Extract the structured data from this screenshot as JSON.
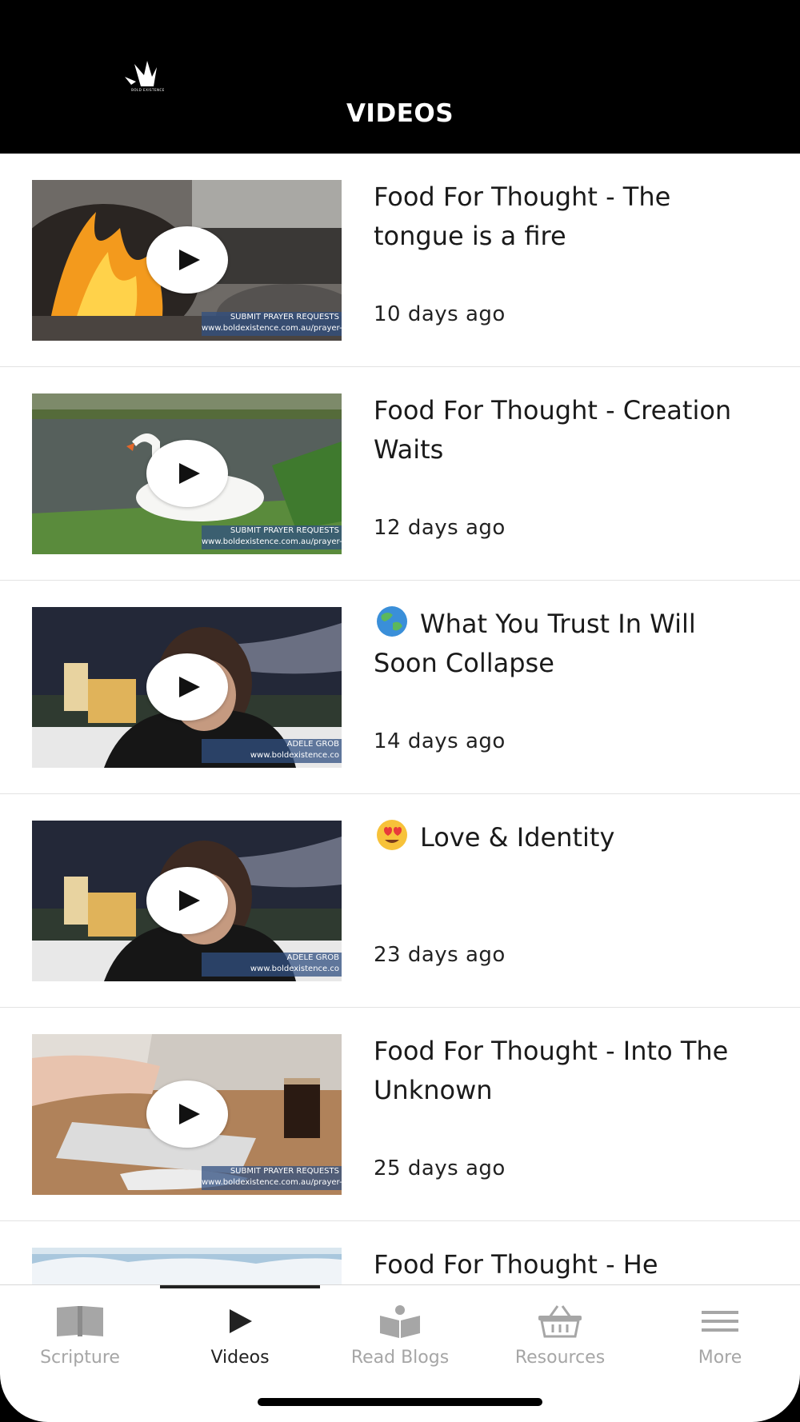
{
  "header": {
    "logo_text": "BOLD EXISTENCE",
    "title": "VIDEOS"
  },
  "videos": [
    {
      "title": "Food For Thought - The tongue is a fire",
      "age": "10 days ago",
      "emoji": "",
      "thumb": "fire",
      "caption_1": "SUBMIT PRAYER REQUESTS",
      "caption_2": "www.boldexistence.com.au/prayer-req"
    },
    {
      "title": "Food For Thought - Creation Waits",
      "age": "12 days ago",
      "emoji": "",
      "thumb": "swan",
      "caption_1": "SUBMIT PRAYER REQUESTS",
      "caption_2": "www.boldexistence.com.au/prayer-reqs"
    },
    {
      "title": "What You Trust In Will Soon Collapse",
      "age": "14 days ago",
      "emoji": "earth-globe-emoji",
      "thumb": "night",
      "caption_1": "ADELE GROB",
      "caption_2": "www.boldexistence.co"
    },
    {
      "title": "Love & Identity",
      "age": "23 days ago",
      "emoji": "heart-eyes-emoji",
      "thumb": "night",
      "caption_1": "ADELE GROB",
      "caption_2": "www.boldexistence.co"
    },
    {
      "title": "Food For Thought - Into The Unknown",
      "age": "25 days ago",
      "emoji": "",
      "thumb": "desk",
      "caption_1": "SUBMIT PRAYER REQUESTS",
      "caption_2": "www.boldexistence.com.au/prayer-req"
    },
    {
      "title": "Food For Thought - He",
      "age": "",
      "emoji": "",
      "thumb": "ice",
      "caption_1": "",
      "caption_2": ""
    }
  ],
  "tabs": [
    {
      "label": "Scripture",
      "icon": "book-icon",
      "active": false
    },
    {
      "label": "Videos",
      "icon": "play-icon",
      "active": true
    },
    {
      "label": "Read Blogs",
      "icon": "reader-icon",
      "active": false
    },
    {
      "label": "Resources",
      "icon": "basket-icon",
      "active": false
    },
    {
      "label": "More",
      "icon": "menu-icon",
      "active": false
    }
  ],
  "colors": {
    "header_bg": "#000000",
    "active_tab": "#222222",
    "inactive_tab": "#a6a6a6"
  }
}
